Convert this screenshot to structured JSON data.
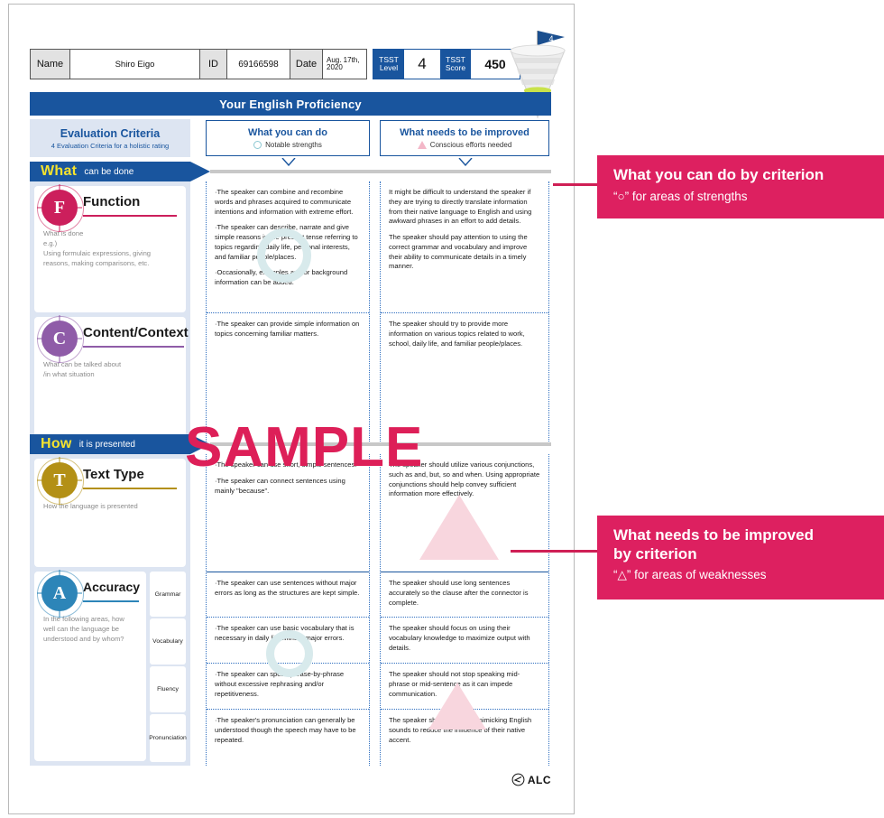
{
  "header": {
    "name_label": "Name",
    "name_value": "Shiro Eigo",
    "id_label": "ID",
    "id_value": "69166598",
    "date_label": "Date",
    "date_value_line1": "Aug. 17th,",
    "date_value_line2": "2020",
    "tsst_level_label_line1": "TSST",
    "tsst_level_label_line2": "Level",
    "tsst_level_value": "4",
    "tsst_score_label_line1": "TSST",
    "tsst_score_label_line2": "Score",
    "tsst_score_value": "450",
    "flag_value": "4"
  },
  "title_bar": "Your English Proficiency",
  "criteria_header": {
    "title": "Evaluation Criteria",
    "subtitle": "4 Evaluation Criteria for a holistic rating"
  },
  "columns": [
    {
      "title": "What you can do",
      "sub": "Notable strengths",
      "icon": "circle-outline-icon"
    },
    {
      "title": "What needs to be improved",
      "sub": "Conscious efforts needed",
      "icon": "triangle-outline-icon"
    }
  ],
  "sections": [
    {
      "band_strong": "What",
      "band_rest": "can be done"
    },
    {
      "band_strong": "How",
      "band_rest": "it is presented"
    }
  ],
  "criteria": [
    {
      "letter": "F",
      "name": "Function",
      "color": "#cc1f5c",
      "description": "What is done\ne.g.)\nUsing formulaic expressions, giving\nreasons, making comparisons, etc.",
      "can_do": [
        "·The speaker can combine and recombine words and phrases acquired to communicate intentions and information with extreme effort.",
        "·The speaker can describe, narrate and give simple reasons in the present tense referring to topics regarding daily life, personal interests, and familiar people/places.",
        "·Occasionally, examples and/or background information can be added."
      ],
      "improve": [
        "It might be difficult to understand the speaker if they are trying to directly translate information from their native language to English and using awkward phrases in an effort to add details.",
        "The speaker should pay attention to using the correct grammar and vocabulary and improve their ability to communicate details in a timely manner."
      ]
    },
    {
      "letter": "C",
      "name": "Content/Context",
      "color": "#8f5ca8",
      "description": "What can be talked about\n/in what situation",
      "can_do": [
        "·The speaker can provide simple information on topics concerning familiar matters."
      ],
      "improve": [
        "The speaker should try to provide more information on various topics related to work, school, daily life, and familiar people/places."
      ]
    },
    {
      "letter": "T",
      "name": "Text Type",
      "color": "#b39016",
      "description": "How the language is presented",
      "can_do": [
        "·The speaker can use short, simple sentences.",
        "·The speaker can connect sentences using mainly \"because\"."
      ],
      "improve": [
        "The speaker should utilize various conjunctions, such as and, but, so and when. Using appropriate conjunctions should help convey sufficient information more effectively."
      ]
    },
    {
      "letter": "A",
      "name": "Accuracy",
      "color": "#2d85b8",
      "description": "In the following areas, how well can the language be understood and by whom?",
      "subcriteria": [
        {
          "label": "Grammar",
          "can_do": "·The speaker can use sentences without major errors as long as the structures are kept simple.",
          "improve": "The speaker should use long sentences accurately so the clause after the connector is complete."
        },
        {
          "label": "Vocabulary",
          "can_do": "·The speaker can use basic vocabulary that is necessary in daily life without major errors.",
          "improve": "The speaker should focus on using their vocabulary knowledge to maximize output with details."
        },
        {
          "label": "Fluency",
          "can_do": "·The speaker can speak phrase-by-phrase without excessive rephrasing and/or repetitiveness.",
          "improve": "The speaker should not stop speaking mid-phrase or mid-sentence as it can impede communication."
        },
        {
          "label": "Pronunciation",
          "can_do": "·The speaker's pronunciation can generally be understood though the speech may have to be repeated.",
          "improve": "The speaker should practice mimicking English sounds to reduce the influence of their native accent."
        }
      ]
    }
  ],
  "watermark": "SAMPLE",
  "footer_logo": "ALC",
  "callouts": [
    {
      "title": "What you can do by criterion",
      "subtitle": "“○” for areas of strengths"
    },
    {
      "title": "What needs to be improved\nby criterion",
      "subtitle": "“△” for areas of weaknesses"
    }
  ],
  "colors": {
    "brand_blue": "#19559e",
    "accent_pink": "#dd2060",
    "band_yellow": "#f5e32e",
    "panel_blue": "#dde5f2"
  }
}
